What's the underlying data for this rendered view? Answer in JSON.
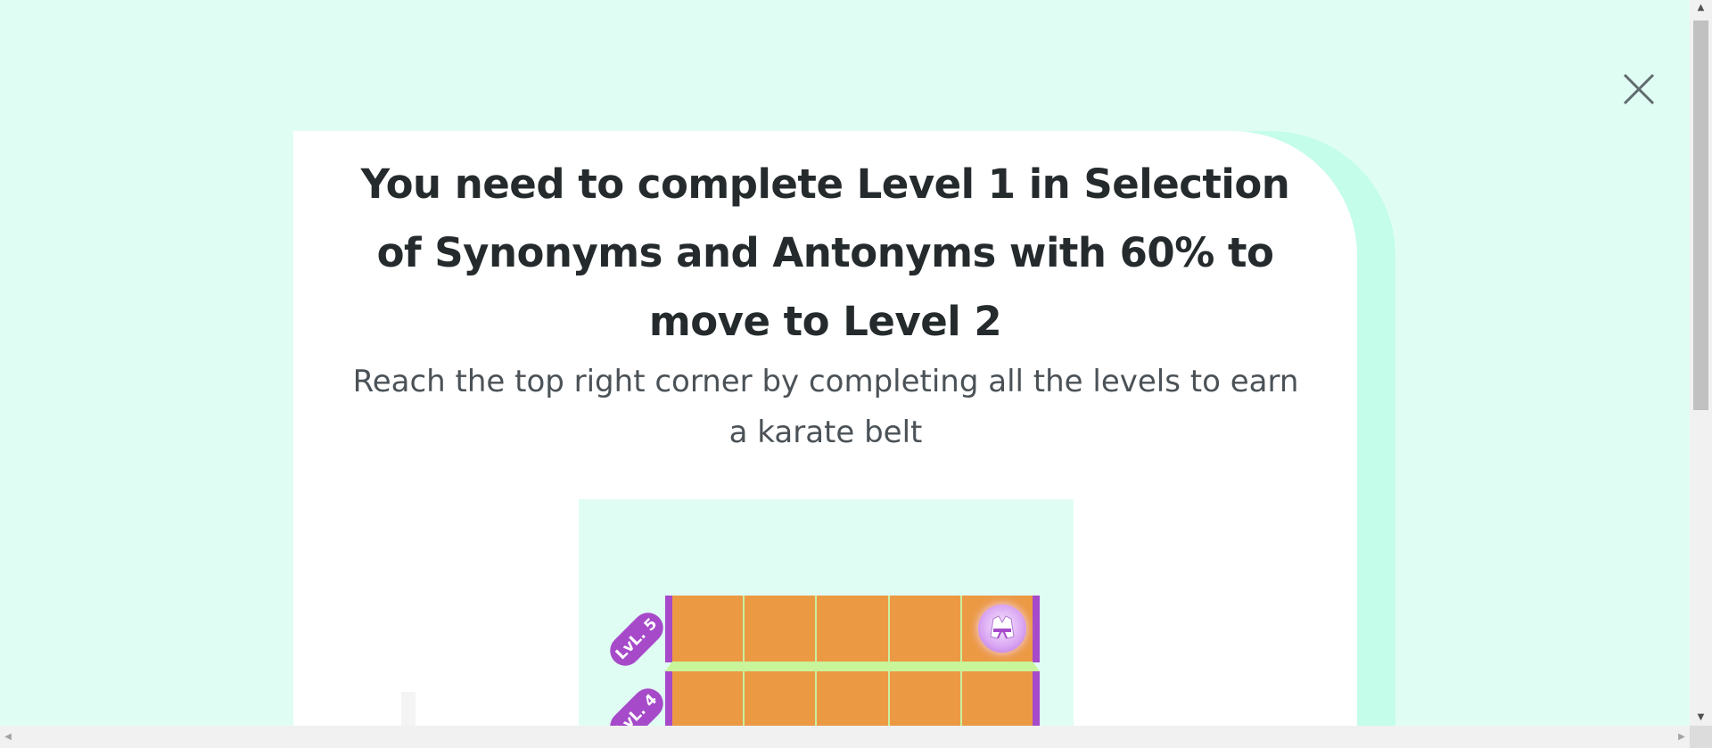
{
  "modal": {
    "close_icon": "close-icon",
    "title": "You need to complete Level 1 in Selection of Synonyms and Antonyms with 60% to move to Level 2",
    "subtitle": "Reach the top right corner by completing all the levels to earn a karate belt"
  },
  "board": {
    "levels": [
      {
        "label": "LvL. 5"
      },
      {
        "label": "LvL. 4"
      }
    ],
    "columns_per_row": 5,
    "reward_icon": "karate-belt-icon",
    "colors": {
      "tile": "#ec9944",
      "rail": "#a64ac9",
      "ledge": "#c9f59a",
      "background": "#e0fdf4"
    }
  },
  "colors": {
    "page_background": "#e0fdf4",
    "card_accent": "#c4fde9",
    "title_text": "#252b2d"
  },
  "scrollbars": {
    "vertical": "scrollbar-vertical",
    "horizontal": "scrollbar-horizontal"
  }
}
